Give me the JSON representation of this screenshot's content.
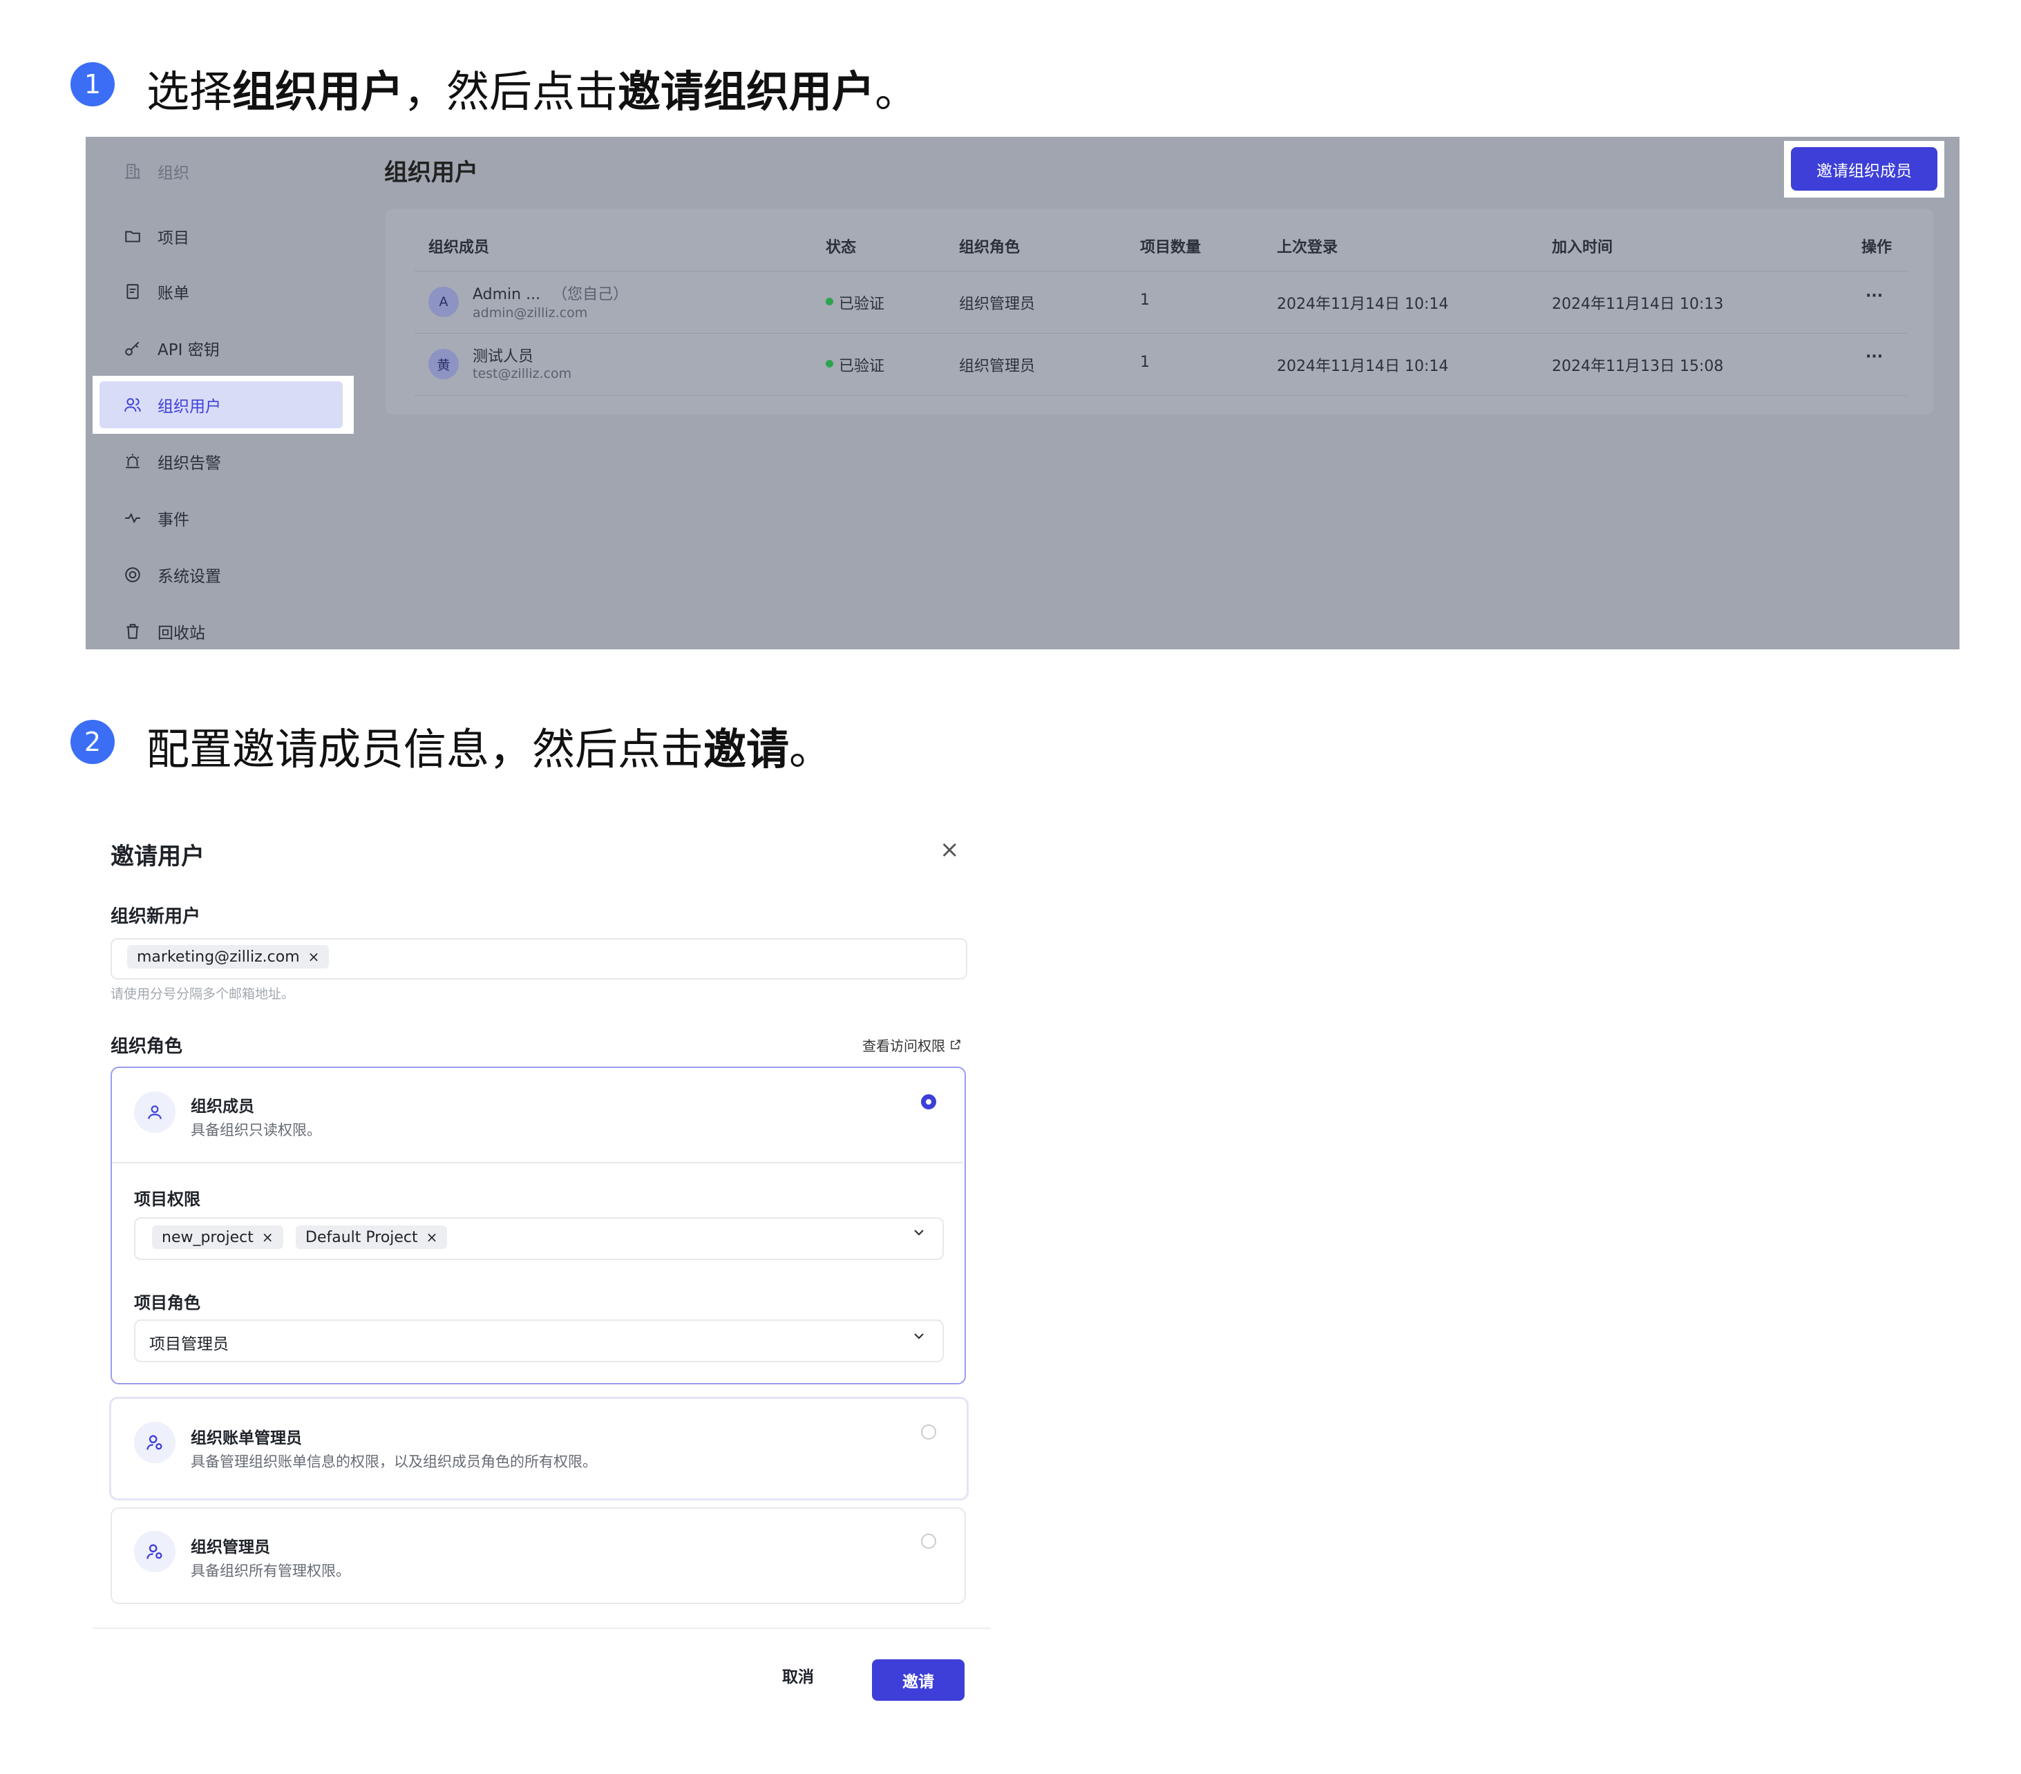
{
  "steps": [
    {
      "number": "1",
      "parts": [
        {
          "text": "选择",
          "bold": false
        },
        {
          "text": "组织用户",
          "bold": true
        },
        {
          "text": "，然后点击",
          "bold": false
        },
        {
          "text": "邀请组织用户",
          "bold": true
        },
        {
          "text": "。",
          "bold": false
        }
      ]
    },
    {
      "number": "2",
      "parts": [
        {
          "text": "配置邀请成员信息，然后点击",
          "bold": false
        },
        {
          "text": "邀请",
          "bold": true
        },
        {
          "text": "。",
          "bold": false
        }
      ]
    }
  ],
  "sidebar": {
    "items": [
      {
        "label": "组织",
        "icon": "building-icon"
      },
      {
        "label": "项目",
        "icon": "folder-icon"
      },
      {
        "label": "账单",
        "icon": "bill-icon"
      },
      {
        "label": "API 密钥",
        "icon": "key-icon"
      },
      {
        "label": "组织用户",
        "icon": "users-icon"
      },
      {
        "label": "组织告警",
        "icon": "alarm-icon"
      },
      {
        "label": "事件",
        "icon": "pulse-icon"
      },
      {
        "label": "系统设置",
        "icon": "gear-icon"
      },
      {
        "label": "回收站",
        "icon": "trash-icon"
      }
    ]
  },
  "users_page": {
    "title": "组织用户",
    "invite_button": "邀请组织成员",
    "columns": [
      "组织成员",
      "状态",
      "组织角色",
      "项目数量",
      "上次登录",
      "加入时间",
      "操作"
    ],
    "rows": [
      {
        "avatar": "A",
        "name": "Admin ...",
        "self_tag": "（您自己）",
        "email": "admin@zilliz.com",
        "status": "已验证",
        "role": "组织管理员",
        "projects": "1",
        "last_login": "2024年11月14日 10:14",
        "joined": "2024年11月14日 10:13",
        "action": "···"
      },
      {
        "avatar": "黄",
        "name": "测试人员",
        "self_tag": "",
        "email": "test@zilliz.com",
        "status": "已验证",
        "role": "组织管理员",
        "projects": "1",
        "last_login": "2024年11月14日 10:14",
        "joined": "2024年11月13日 15:08",
        "action": "···"
      }
    ]
  },
  "dialog": {
    "title": "邀请用户",
    "close": "×",
    "new_users_label": "组织新用户",
    "email_chip": "marketing@zilliz.com",
    "chip_remove": "×",
    "email_hint": "请使用分号分隔多个邮箱地址。",
    "role_label": "组织角色",
    "view_permissions": "查看访问权限",
    "roles": [
      {
        "title": "组织成员",
        "desc": "具备组织只读权限。",
        "selected": true
      },
      {
        "title": "组织账单管理员",
        "desc": "具备管理组织账单信息的权限，以及组织成员角色的所有权限。",
        "selected": false
      },
      {
        "title": "组织管理员",
        "desc": "具备组织所有管理权限。",
        "selected": false
      }
    ],
    "project_perm_label": "项目权限",
    "project_chips": [
      "new_project",
      "Default Project"
    ],
    "project_role_label": "项目角色",
    "project_role_value": "项目管理员",
    "cancel": "取消",
    "invite": "邀请"
  },
  "colors": {
    "accent": "#3d3fd8",
    "step_badge": "#3b6ef5",
    "verified": "#2ea44f"
  }
}
